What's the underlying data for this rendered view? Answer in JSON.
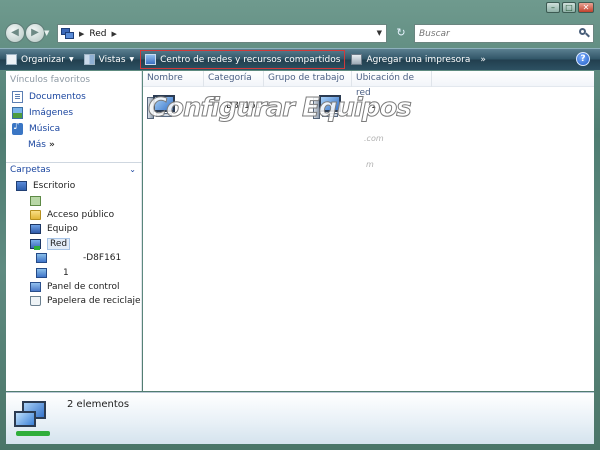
{
  "nav": {
    "address_text": "Red",
    "search_placeholder": "Buscar"
  },
  "toolbar": {
    "organize": "Organizar",
    "views": "Vistas",
    "network_center": "Centro de redes y recursos compartidos",
    "add_printer": "Agregar una impresora",
    "more": "»",
    "help": "?"
  },
  "favorites": {
    "header": "Vínculos favoritos",
    "items": [
      "Documentos",
      "Imágenes",
      "Música"
    ],
    "more": "Más"
  },
  "folders": {
    "header": "Carpetas",
    "items": [
      {
        "label": "Escritorio",
        "icon": "desktop-icon"
      },
      {
        "label": "",
        "icon": "user-folder-icon"
      },
      {
        "label": "Acceso público",
        "icon": "folder-icon"
      },
      {
        "label": "Equipo",
        "icon": "computer-icon"
      },
      {
        "label": "Red",
        "icon": "network-icon"
      },
      {
        "label": "-D8F161",
        "icon": "computer-icon"
      },
      {
        "label": "1",
        "icon": "computer-icon"
      },
      {
        "label": "Panel de control",
        "icon": "control-panel-icon"
      },
      {
        "label": "Papelera de reciclaje",
        "icon": "recycle-bin-icon"
      }
    ]
  },
  "columns": [
    "Nombre",
    "Categoría",
    "Grupo de trabajo",
    "Ubicación de red"
  ],
  "files": [
    {
      "name": "-D8F161"
    },
    {
      "name": "1"
    }
  ],
  "watermark": {
    "main": "Configurar Equipos",
    "small1": ".com",
    "small2": "m"
  },
  "details": {
    "count": "2 elementos"
  }
}
